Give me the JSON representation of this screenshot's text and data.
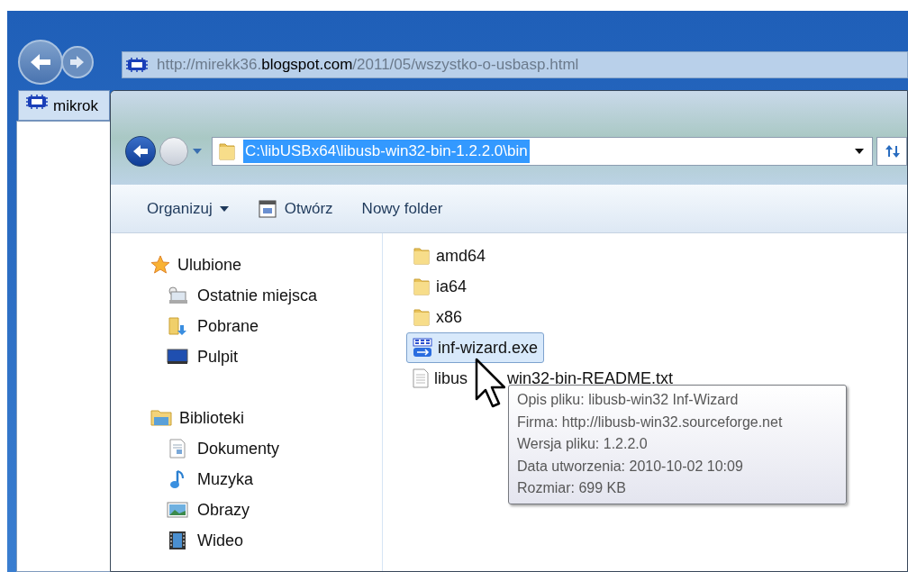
{
  "browser": {
    "address": "http://mirekk36.**blogspot.com**/2011/05/wszystko-o-usbasp.html",
    "tab": {
      "label": "mikrok",
      "selected": true
    }
  },
  "explorer": {
    "address": {
      "value": "C:\\libUSBx64\\libusb-win32-bin-1.2.2.0\\bin",
      "selected": true
    },
    "toolbar": [
      {
        "label": "Organizuj",
        "kind": "menu"
      },
      {
        "label": "Otwórz",
        "kind": "open"
      },
      {
        "label": "Nowy folder",
        "kind": "plain"
      }
    ],
    "sidebar": [
      {
        "label": "Ulubione",
        "children": [
          {
            "label": "Ostatnie miejsca"
          },
          {
            "label": "Pobrane"
          },
          {
            "label": "Pulpit"
          }
        ]
      },
      {
        "label": "Biblioteki",
        "children": [
          {
            "label": "Dokumenty"
          },
          {
            "label": "Muzyka"
          },
          {
            "label": "Obrazy"
          },
          {
            "label": "Wideo"
          }
        ]
      }
    ],
    "files": [
      {
        "name": "amd64",
        "kind": "folder",
        "selected": false
      },
      {
        "name": "ia64",
        "kind": "folder",
        "selected": false
      },
      {
        "name": "x86",
        "kind": "folder",
        "selected": false
      },
      {
        "name": "inf-wizard.exe",
        "kind": "exe",
        "selected": true
      },
      {
        "name_parts": [
          "libus",
          "win32-bin-README.txt"
        ],
        "kind": "text",
        "selected": false
      }
    ],
    "tooltip": [
      "Opis pliku: libusb-win32 Inf-Wizard",
      "Firma: http://libusb-win32.sourceforge.net",
      "Wersja pliku: 1.2.2.0",
      "Data utworzenia: 2010-10-02 10:09",
      "Rozmiar: 699 KB"
    ]
  }
}
